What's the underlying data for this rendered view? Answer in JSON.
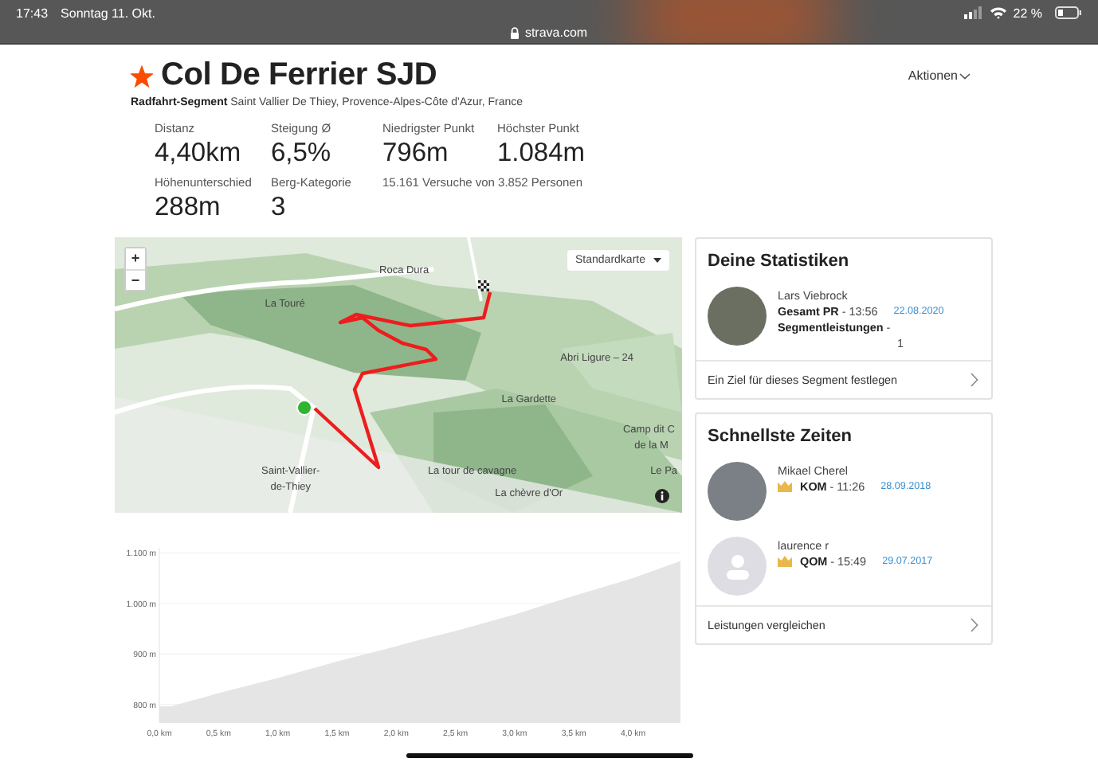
{
  "status_bar": {
    "time": "17:43",
    "date": "Sonntag 11. Okt.",
    "url": "strava.com",
    "battery": "22 %"
  },
  "segment": {
    "title": "Col De Ferrier SJD",
    "starred": true,
    "type": "Radfahrt-Segment",
    "location": "Saint Vallier De Thiey, Provence-Alpes-Côte d'Azur, France",
    "actions": "Aktionen"
  },
  "stats": [
    {
      "label": "Distanz",
      "value": "4,40km"
    },
    {
      "label": "Steigung Ø",
      "value": "6,5%"
    },
    {
      "label": "Niedrigster Punkt",
      "value": "796m"
    },
    {
      "label": "Höchster Punkt",
      "value": "1.084m"
    },
    {
      "label": "Höhenunterschied",
      "value": "288m"
    },
    {
      "label": "Berg-Kategorie",
      "value": "3"
    },
    {
      "label": "15.161 Versuche von 3.852 Personen"
    }
  ],
  "map": {
    "zoom_in": "+",
    "zoom_out": "−",
    "style": "Standardkarte",
    "labels": [
      "Roca Dura",
      "La Touré",
      "Abri Ligure – 24",
      "La Gardette",
      "Camp dit C",
      "de la M",
      "Saint-Vallier-",
      "La tour de cavagne",
      "Le Pa",
      "de-Thiey",
      "La chèvre d'Or"
    ]
  },
  "elevation": {
    "chart_data": {
      "type": "area",
      "x": [
        0,
        0.1,
        0.5,
        1.0,
        1.5,
        2.0,
        2.2,
        2.5,
        3.0,
        3.5,
        4.0,
        4.4
      ],
      "grid": true,
      "series": [
        {
          "color": "#e5e5e5",
          "values": [
            796,
            796,
            822,
            852,
            885,
            915,
            928,
            945,
            978,
            1015,
            1050,
            1084
          ]
        }
      ],
      "xlim": [
        0,
        4.4
      ],
      "ylim": [
        763,
        1110
      ],
      "xticks": [
        {
          "value": 0,
          "label": "0,0 km"
        },
        {
          "value": 0.5,
          "label": "0,5 km"
        },
        {
          "value": 1,
          "label": "1,0 km"
        },
        {
          "value": 1.5,
          "label": "1,5 km"
        },
        {
          "value": 2,
          "label": "2,0 km"
        },
        {
          "value": 2.5,
          "label": "2,5 km"
        },
        {
          "value": 3,
          "label": "3,0 km"
        },
        {
          "value": 3.5,
          "label": "3,5 km"
        },
        {
          "value": 4,
          "label": "4,0 km"
        }
      ],
      "yticks": [
        {
          "value": 800,
          "label": "800 m"
        },
        {
          "value": 900,
          "label": "900 m"
        },
        {
          "value": 1000,
          "label": "1.000 m"
        },
        {
          "value": 1100,
          "label": "1.100 m"
        }
      ]
    }
  },
  "my_stats": {
    "title": "Deine Statistiken",
    "name": "Lars Viebrock",
    "pr_label": "Gesamt PR",
    "pr_time": "- 13:56",
    "date": "22.08.2020",
    "efforts_label": "Segmentleistungen",
    "efforts_sep": "-",
    "efforts": "1",
    "link": "Ein Ziel für dieses Segment festlegen"
  },
  "fastest": {
    "title": "Schnellste Zeiten",
    "entries": [
      {
        "name": "Mikael Cherel",
        "kind": "photo",
        "title": "KOM",
        "time": "- 11:26",
        "date": "28.09.2018"
      },
      {
        "name": "laurence r",
        "kind": "default",
        "title": "QOM",
        "time": "- 15:49",
        "date": "29.07.2017"
      }
    ],
    "link": "Leistungen vergleichen"
  }
}
